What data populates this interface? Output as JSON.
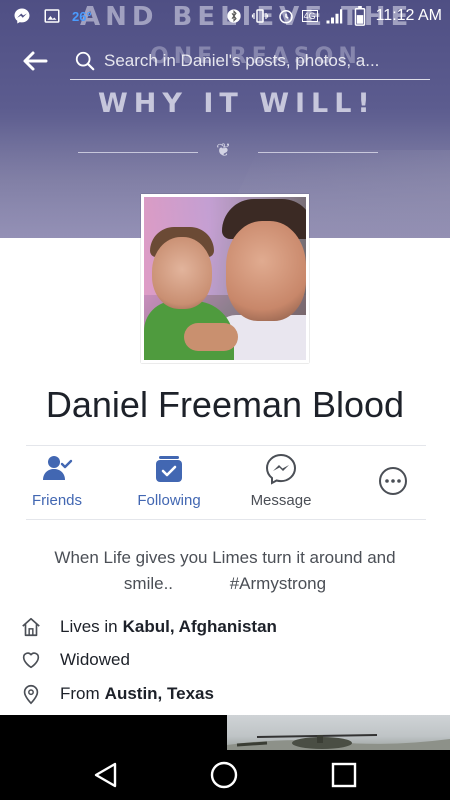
{
  "status_bar": {
    "temperature": "26°",
    "network": "4G",
    "time": "11:12 AM",
    "icons": [
      "messenger-icon",
      "gallery-icon",
      "bluetooth-icon",
      "vibrate-icon",
      "alarm-icon",
      "signal-icon",
      "battery-icon"
    ]
  },
  "cover": {
    "line1": "AND BELIEVE THE",
    "line2": "ONE REASON",
    "line3": "WHY IT WILL!"
  },
  "search": {
    "placeholder": "Search in Daniel's posts, photos, a..."
  },
  "profile": {
    "name": "Daniel Freeman Blood"
  },
  "actions": [
    {
      "label": "Friends",
      "icon": "friends-icon",
      "color": "#4267b2"
    },
    {
      "label": "Following",
      "icon": "following-icon",
      "color": "#4267b2"
    },
    {
      "label": "Message",
      "icon": "messenger-icon",
      "color": "#4b4f56"
    },
    {
      "label": "",
      "icon": "more-icon",
      "color": "#4b4f56"
    }
  ],
  "bio": {
    "line1": "When Life gives you Limes turn it around and",
    "line2": "smile..            #Armystrong"
  },
  "info": {
    "lives_prefix": "Lives in",
    "lives_value": "Kabul, Afghanistan",
    "relationship": "Widowed",
    "from_prefix": "From",
    "from_value": "Austin, Texas"
  },
  "colors": {
    "accent": "#4267b2",
    "text": "#1d2129",
    "secondary": "#4b4f56"
  }
}
